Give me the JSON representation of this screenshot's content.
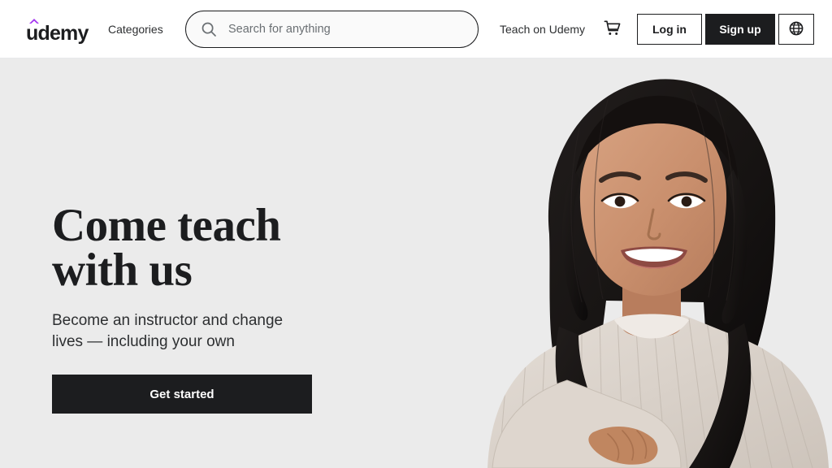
{
  "header": {
    "logo_text": "udemy",
    "logo_accent_color": "#a435f0",
    "categories_label": "Categories",
    "search": {
      "placeholder": "Search for anything",
      "value": "",
      "icon": "search-icon"
    },
    "teach_link_label": "Teach on Udemy",
    "cart_icon": "shopping-cart-icon",
    "login_label": "Log in",
    "signup_label": "Sign up",
    "language_icon": "globe-icon"
  },
  "hero": {
    "title_line1": "Come teach",
    "title_line2": "with us",
    "subtitle": "Become an instructor and change lives — including your own",
    "cta_label": "Get started",
    "background_color": "#ebebeb",
    "photo_alt": "smiling-instructor-portrait"
  },
  "colors": {
    "brand_purple": "#a435f0",
    "ink": "#1c1d1f",
    "muted": "#6a6f73",
    "hero_bg": "#ebebeb"
  }
}
